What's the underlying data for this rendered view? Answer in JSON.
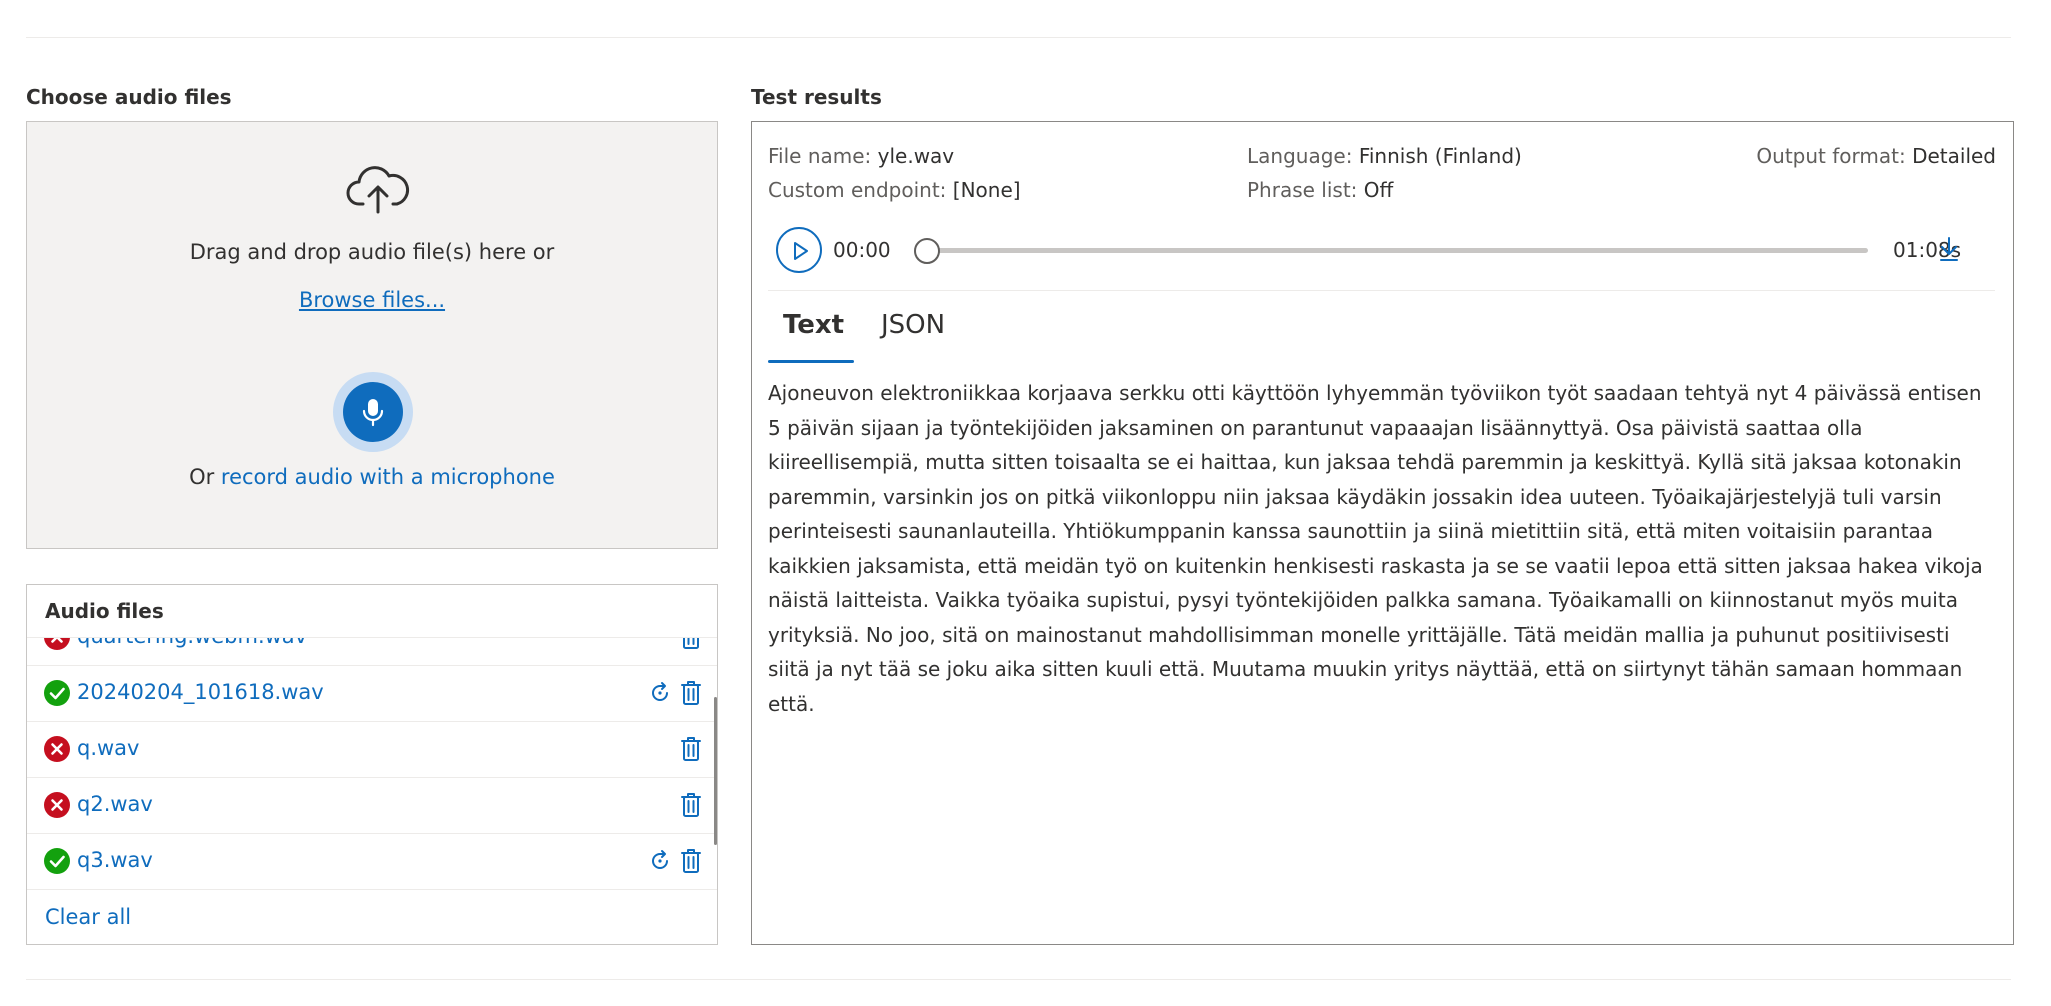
{
  "choose": {
    "title": "Choose audio files",
    "drag_text": "Drag and drop audio file(s) here or",
    "browse_label": "Browse files...",
    "record_prefix": "Or ",
    "record_link": "record audio with a microphone"
  },
  "audio_files": {
    "title": "Audio files",
    "items": [
      {
        "name": "quartering.webm.wav",
        "status": "error",
        "retry": false
      },
      {
        "name": "20240204_101618.wav",
        "status": "success",
        "retry": true
      },
      {
        "name": "q.wav",
        "status": "error",
        "retry": false
      },
      {
        "name": "q2.wav",
        "status": "error",
        "retry": false
      },
      {
        "name": "q3.wav",
        "status": "success",
        "retry": true
      }
    ],
    "clear_all": "Clear all"
  },
  "results": {
    "title": "Test results",
    "file_name_label": "File name:",
    "file_name": "yle.wav",
    "language_label": "Language:",
    "language": "Finnish (Finland)",
    "output_format_label": "Output format:",
    "output_format": "Detailed",
    "custom_endpoint_label": "Custom endpoint:",
    "custom_endpoint": "[None]",
    "phrase_list_label": "Phrase list:",
    "phrase_list": "Off",
    "player": {
      "current_time": "00:00",
      "duration": "01:08s",
      "progress": 0
    },
    "tabs": [
      {
        "label": "Text",
        "active": true
      },
      {
        "label": "JSON",
        "active": false
      }
    ],
    "transcript": "Ajoneuvon elektroniikkaa korjaava serkku otti käyttöön lyhyemmän työviikon työt saadaan tehtyä nyt 4 päivässä entisen 5 päivän sijaan ja työntekijöiden jaksaminen on parantunut vapaaajan lisäännyttyä. Osa päivistä saattaa olla kiireellisempiä, mutta sitten toisaalta se ei haittaa, kun jaksaa tehdä paremmin ja keskittyä. Kyllä sitä jaksaa kotonakin paremmin, varsinkin jos on pitkä viikonloppu niin jaksaa käydäkin jossakin idea uuteen. Työaikajärjestelyjä tuli varsin perinteisesti saunanlauteilla. Yhtiökumppanin kanssa saunottiin ja siinä mietittiin sitä, että miten voitaisiin parantaa kaikkien jaksamista, että meidän työ on kuitenkin henkisesti raskasta ja se se vaatii lepoa että sitten jaksaa hakea vikoja näistä laitteista. Vaikka työaika supistui, pysyi työntekijöiden palkka samana. Työaikamalli on kiinnostanut myös muita yrityksiä. No joo, sitä on mainostanut mahdollisimman monelle yrittäjälle. Tätä meidän mallia ja puhunut positiivisesti siitä ja nyt tää se joku aika sitten kuuli että. Muutama muukin yritys näyttää, että on siirtynyt tähän samaan hommaan että."
  },
  "colors": {
    "accent": "#0f6cbd",
    "success": "#13a10e",
    "error": "#c50f1f"
  }
}
